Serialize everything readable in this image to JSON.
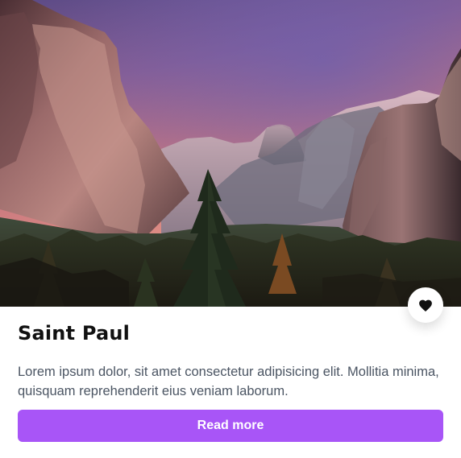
{
  "card": {
    "image": {
      "alt": "Mountain valley at sunset"
    },
    "favorite": {
      "icon": "heart-icon"
    },
    "title": "Saint Paul",
    "description": "Lorem ipsum dolor, sit amet consectetur adipisicing elit. Mollitia minima, quisquam reprehenderit eius veniam laborum.",
    "button_label": "Read more"
  },
  "colors": {
    "accent": "#a855f7",
    "title": "#111111",
    "text": "#4b5563",
    "background": "#ffffff"
  }
}
